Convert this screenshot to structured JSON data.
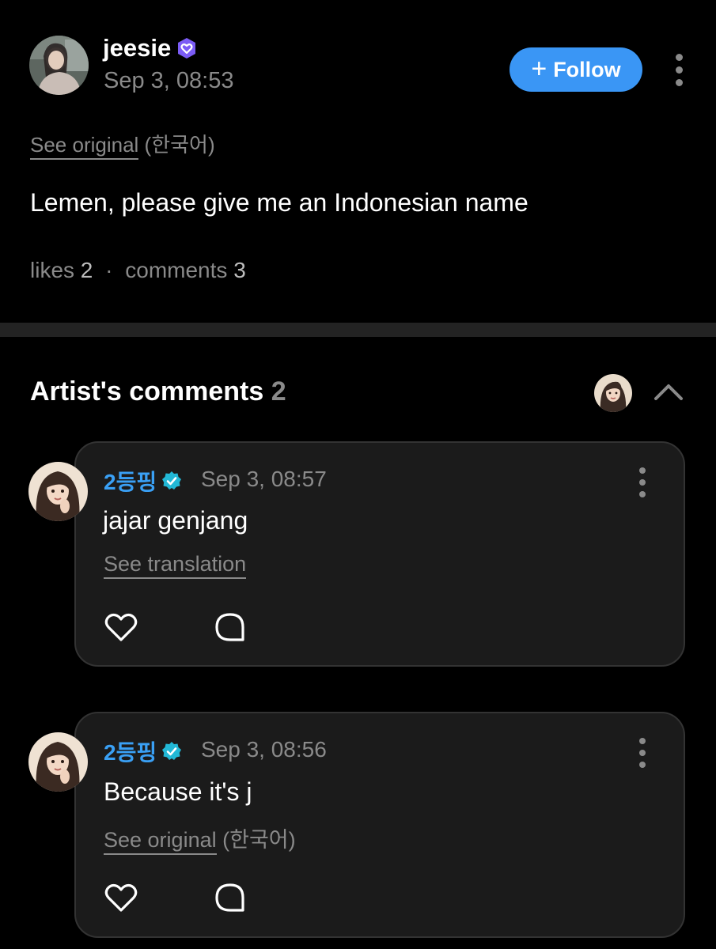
{
  "post": {
    "author": "jeesie",
    "timestamp": "Sep 3, 08:53",
    "follow_label": "Follow",
    "see_original": "See original",
    "original_language": "(한국어)",
    "body": "Lemen, please give me an Indonesian name",
    "likes_label": "likes",
    "likes_count": "2",
    "separator": "·",
    "comments_label": "comments",
    "comments_count": "3"
  },
  "artist_comments": {
    "title": "Artist's comments",
    "count": "2",
    "comments": [
      {
        "author": "2등핑",
        "timestamp": "Sep 3, 08:57",
        "text": "jajar genjang",
        "link_label": "See translation"
      },
      {
        "author": "2등핑",
        "timestamp": "Sep 3, 08:56",
        "text": "Because it's j",
        "link_label": "See original",
        "original_language": "(한국어)"
      }
    ]
  },
  "colors": {
    "background": "#000000",
    "accent_blue": "#3a96f5",
    "username_blue": "#3aa0f5",
    "verified_purple": "#7b5cf5",
    "verified_teal": "#22b8d6",
    "muted_text": "#8a8a8a",
    "card_background": "#1b1b1b"
  },
  "icons": {
    "verified_badge_post": "verified-heart-badge-icon",
    "verified_badge_comment": "verified-check-badge-icon",
    "more": "more-vertical-icon",
    "collapse": "chevron-up-icon",
    "like": "heart-outline-icon",
    "reply": "comment-bubble-icon",
    "follow": "plus-icon"
  }
}
